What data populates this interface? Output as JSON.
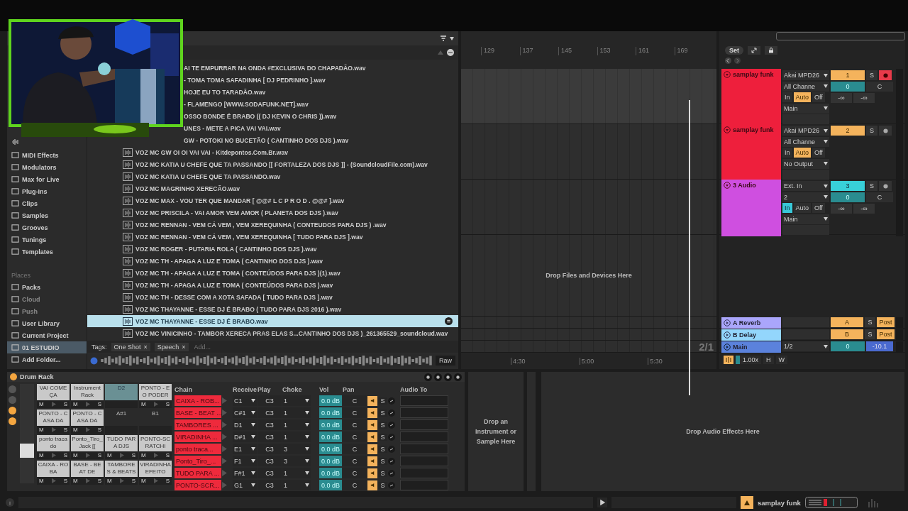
{
  "browser": {
    "sidebar": {
      "categories": [
        {
          "label": "MIDI Effects",
          "selected": false,
          "disabled": false
        },
        {
          "label": "Modulators",
          "selected": false,
          "disabled": false
        },
        {
          "label": "Max for Live",
          "selected": false,
          "disabled": false
        },
        {
          "label": "Plug-Ins",
          "selected": false,
          "disabled": false
        },
        {
          "label": "Clips",
          "selected": false,
          "disabled": false
        },
        {
          "label": "Samples",
          "selected": false,
          "disabled": false
        },
        {
          "label": "Grooves",
          "selected": false,
          "disabled": false
        },
        {
          "label": "Tunings",
          "selected": false,
          "disabled": false
        },
        {
          "label": "Templates",
          "selected": false,
          "disabled": false
        }
      ],
      "places_header": "Places",
      "places": [
        {
          "label": "Packs",
          "selected": false,
          "disabled": false
        },
        {
          "label": "Cloud",
          "selected": false,
          "disabled": true
        },
        {
          "label": "Push",
          "selected": false,
          "disabled": true
        },
        {
          "label": "User Library",
          "selected": false,
          "disabled": false
        },
        {
          "label": "Current Project",
          "selected": false,
          "disabled": false
        },
        {
          "label": "01 ESTUDIO",
          "selected": true,
          "disabled": false
        },
        {
          "label": "Add Folder...",
          "selected": false,
          "disabled": false
        }
      ]
    },
    "files": [
      {
        "name": "AI TE EMPURRAR NA ONDA #EXCLUSIVA DO CHAPADÃO.wav",
        "covered": true,
        "selected": false
      },
      {
        "name": "- TOMA TOMA SAFADINHA [ DJ PEDRINHO ].wav",
        "covered": true,
        "selected": false
      },
      {
        "name": "HOJE EU TO TARADÃO.wav",
        "covered": true,
        "selected": false
      },
      {
        "name": "- FLAMENGO  [WWW.SODAFUNK.NET].wav",
        "covered": true,
        "selected": false
      },
      {
        "name": "OSSO BONDE É BRABO ((   DJ KEVIN O CHRIS  )).wav",
        "covered": true,
        "selected": false
      },
      {
        "name": "UNES - METE A PICA VAI VAI.wav",
        "covered": true,
        "selected": false
      },
      {
        "name": "GW - POTOKI NO BUCETÃO ( CANTINHO DOS DJS ).wav",
        "covered": true,
        "selected": false
      },
      {
        "name": "VOZ MC GW OI OI VAI VAI - Kitdepontos.Com.Br.wav",
        "covered": false,
        "selected": false
      },
      {
        "name": "VOZ MC KATIA U CHEFE QUE TA PASSANDO [[ FORTALEZA DOS DJS ]] - (SoundcloudFile.com).wav",
        "covered": false,
        "selected": false
      },
      {
        "name": "VOZ MC KATIA U CHEFE QUE TA PASSANDO.wav",
        "covered": false,
        "selected": false
      },
      {
        "name": "VOZ MC MAGRINHO XERECÃO.wav",
        "covered": false,
        "selected": false
      },
      {
        "name": "VOZ MC MAX - VOU TER QUE MANDAR [ @@# L C P R O D . @@# ].wav",
        "covered": false,
        "selected": false
      },
      {
        "name": "VOZ MC PRISCILA - VAI AMOR VEM AMOR ( PLANETA DOS DJS ).wav",
        "covered": false,
        "selected": false
      },
      {
        "name": "VOZ MC RENNAN - VEM CÁ VEM , VEM XEREQUINHA ( CONTEUDOS PARA DJS ) .wav",
        "covered": false,
        "selected": false
      },
      {
        "name": "VOZ MC RENNAN - VEM CÁ VEM , VEM XEREQUINHA [ TUDO PARA DJS ].wav",
        "covered": false,
        "selected": false
      },
      {
        "name": "VOZ MC ROGER - PUTARIA ROLA ( CANTINHO DOS DJS ).wav",
        "covered": false,
        "selected": false
      },
      {
        "name": "VOZ MC TH - APAGA A LUZ E TOMA ( CANTINHO DOS DJS ).wav",
        "covered": false,
        "selected": false
      },
      {
        "name": "VOZ MC TH - APAGA A LUZ E TOMA ( CONTEÚDOS PARA DJS )(1).wav",
        "covered": false,
        "selected": false
      },
      {
        "name": "VOZ MC TH - APAGA A LUZ E TOMA ( CONTEÚDOS PARA DJS ).wav",
        "covered": false,
        "selected": false
      },
      {
        "name": "VOZ MC TH - DESSE COM A XOTA SAFADA [ TUDO PARA DJS ].wav",
        "covered": false,
        "selected": false
      },
      {
        "name": "VOZ MC THAYANNE - ESSE DJ É BRABO ( TUDO PARA DJS 2016 ).wav",
        "covered": false,
        "selected": false
      },
      {
        "name": "VOZ MC THAYANNE - ESSE DJ É BRABO.wav",
        "covered": false,
        "selected": true
      },
      {
        "name": "VOZ MC VINICINHO - TAMBOR XERECA PRAS ELAS S...CANTINHO DOS DJS )_261365529_soundcloud.wav",
        "covered": false,
        "selected": false
      }
    ],
    "tags": {
      "label": "Tags:",
      "chips": [
        {
          "label": "One Shot",
          "remove": "×"
        },
        {
          "label": "Speech",
          "remove": "×"
        }
      ],
      "placeholder": "Add..."
    },
    "preview": {
      "button": "Raw"
    }
  },
  "arrangement": {
    "bars": [
      "129",
      "137",
      "145",
      "153",
      "161",
      "169"
    ],
    "drop_hint": "Drop Files and Devices Here",
    "zoom_label": "2/1",
    "times": [
      "4:30",
      "5:00",
      "5:30"
    ]
  },
  "mixer": {
    "set_button": "Set",
    "tracks": [
      {
        "name": "samplay funk",
        "color": "#ee1f3c",
        "input": "Akai MPD26",
        "channel": "All Channe",
        "monitor": [
          {
            "label": "In",
            "selected": false
          },
          {
            "label": "Auto",
            "selected": true
          },
          {
            "label": "Off",
            "selected": false
          }
        ],
        "output": "Main",
        "number": "1",
        "selected": false,
        "solo": "S",
        "armed": true,
        "volume": "0",
        "pan": "C",
        "peaks": [
          "-∞",
          "-∞"
        ]
      },
      {
        "name": "samplay funk",
        "color": "#ee1f3c",
        "input": "Akai MPD26",
        "channel": "All Channe",
        "monitor": [
          {
            "label": "In",
            "selected": false
          },
          {
            "label": "Auto",
            "selected": true
          },
          {
            "label": "Off",
            "selected": false
          }
        ],
        "output": "No Output",
        "number": "2",
        "selected": false,
        "solo": "S",
        "armed": false
      },
      {
        "name": "3 Audio",
        "color": "#cf4fe0",
        "input": "Ext. In",
        "channel": "2",
        "monitor": [
          {
            "label": "In",
            "selected": true
          },
          {
            "label": "Auto",
            "selected": false
          },
          {
            "label": "Off",
            "selected": false
          }
        ],
        "output": "Main",
        "number": "3",
        "selected": true,
        "solo": "S",
        "armed": false,
        "volume": "0",
        "pan": "C",
        "peaks": [
          "-∞",
          "-∞"
        ]
      }
    ],
    "returns": [
      {
        "name": "A Reverb",
        "color": "#aaa6fb",
        "letter": "A",
        "solo": "S",
        "mode": "Post"
      },
      {
        "name": "B Delay",
        "color": "#93d6fc",
        "letter": "B",
        "solo": "S",
        "mode": "Post"
      }
    ],
    "main": {
      "name": "Main",
      "color": "#5b82dc",
      "output": "1/2",
      "volume": "0",
      "readout": "-10.1"
    },
    "footer": {
      "speed": "1.00x",
      "buttons": [
        "H",
        "W"
      ]
    }
  },
  "device": {
    "title": "Drum Rack",
    "on": true,
    "pads": [
      {
        "kind": "sample",
        "name": "VAI COMEÇA",
        "selected": false,
        "mute": "M",
        "solo": "S"
      },
      {
        "kind": "sample",
        "name": "Instrument Rack",
        "selected": false,
        "mute": "M",
        "solo": "S"
      },
      {
        "kind": "empty",
        "name": "D2",
        "selected": true
      },
      {
        "kind": "sample",
        "name": "PONTO - E O PODER",
        "selected": false,
        "mute": "M",
        "solo": "S"
      },
      {
        "kind": "sample",
        "name": "PONTO - CASA DA",
        "selected": false,
        "mute": "M",
        "solo": "S"
      },
      {
        "kind": "sample",
        "name": "PONTO - CASA DA",
        "selected": false,
        "mute": "M",
        "solo": "S"
      },
      {
        "kind": "empty",
        "name": "A#1",
        "selected": false
      },
      {
        "kind": "empty",
        "name": "B1",
        "selected": false
      },
      {
        "kind": "sample",
        "name": "ponto tracado",
        "selected": false,
        "mute": "M",
        "solo": "S"
      },
      {
        "kind": "sample",
        "name": "Ponto_Tiro_Jack [[",
        "selected": false,
        "mute": "M",
        "solo": "S"
      },
      {
        "kind": "sample",
        "name": "TUDO PARA DJS",
        "selected": false,
        "mute": "M",
        "solo": "S"
      },
      {
        "kind": "sample",
        "name": "PONTO-SCRATCHI",
        "selected": false,
        "mute": "M",
        "solo": "S"
      },
      {
        "kind": "sample",
        "name": "CAIXA - ROBA",
        "selected": false,
        "mute": "M",
        "solo": "S"
      },
      {
        "kind": "sample",
        "name": "BASE - BEAT DE",
        "selected": false,
        "mute": "M",
        "solo": "S"
      },
      {
        "kind": "sample",
        "name": "TAMBORES & BEATS",
        "selected": false,
        "mute": "M",
        "solo": "S"
      },
      {
        "kind": "sample",
        "name": "VIRADINHA EFEITO",
        "selected": false,
        "mute": "M",
        "solo": "S"
      }
    ],
    "columns": [
      "Chain",
      "Receive",
      "Play",
      "Choke",
      "Vol",
      "Pan",
      "Audio To"
    ],
    "chains": [
      {
        "name": "CAIXA - ROB...",
        "receive": "C1",
        "play": "C3",
        "choke": "1",
        "volume": "0.0 dB",
        "pan": "C",
        "speaker_on": true,
        "solo": "S"
      },
      {
        "name": "BASE - BEAT ...",
        "receive": "C#1",
        "play": "C3",
        "choke": "1",
        "volume": "0.0 dB",
        "pan": "C",
        "speaker_on": true,
        "solo": "S"
      },
      {
        "name": "TAMBORES ...",
        "receive": "D1",
        "play": "C3",
        "choke": "1",
        "volume": "0.0 dB",
        "pan": "C",
        "speaker_on": true,
        "solo": "S"
      },
      {
        "name": "VIRADINHA ...",
        "receive": "D#1",
        "play": "C3",
        "choke": "1",
        "volume": "0.0 dB",
        "pan": "C",
        "speaker_on": true,
        "solo": "S"
      },
      {
        "name": "ponto traca...",
        "receive": "E1",
        "play": "C3",
        "choke": "3",
        "volume": "0.0 dB",
        "pan": "C",
        "speaker_on": true,
        "solo": "S"
      },
      {
        "name": "Ponto_Tiro_...",
        "receive": "F1",
        "play": "C3",
        "choke": "3",
        "volume": "0.0 dB",
        "pan": "C",
        "speaker_on": true,
        "solo": "S"
      },
      {
        "name": "TUDO PARA ...",
        "receive": "F#1",
        "play": "C3",
        "choke": "1",
        "volume": "0.0 dB",
        "pan": "C",
        "speaker_on": true,
        "solo": "S"
      },
      {
        "name": "PONTO-SCR...",
        "receive": "G1",
        "play": "C3",
        "choke": "1",
        "volume": "0.0 dB",
        "pan": "C",
        "speaker_on": true,
        "solo": "S"
      }
    ],
    "instrument_hint": "Drop an Instrument or Sample Here",
    "effects_hint": "Drop Audio Effects Here"
  },
  "status_bar": {
    "track_name": "samplay funk"
  }
}
